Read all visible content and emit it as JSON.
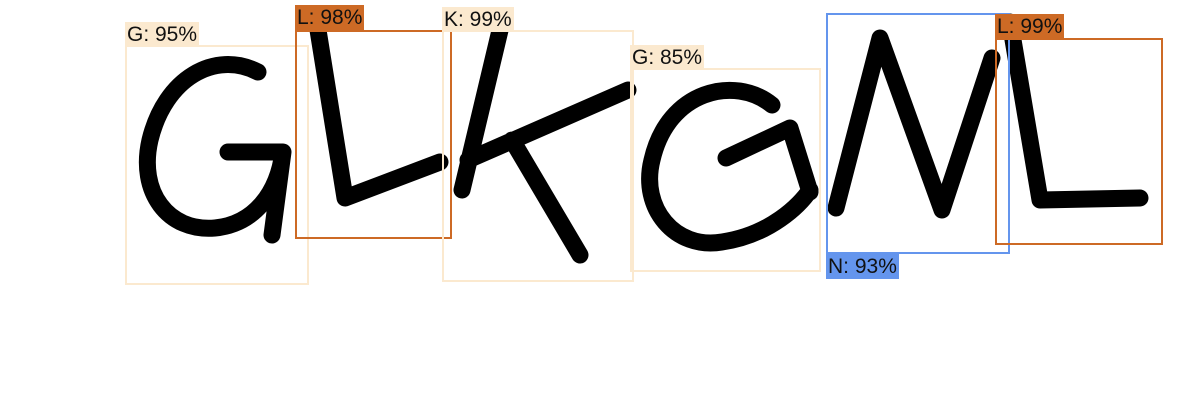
{
  "image": {
    "content": "captcha text rendered in distorted black handwriting with character detection boxes"
  },
  "detections": [
    {
      "label": "G: 95%",
      "char": "G",
      "confidence": 0.95,
      "color": "#fbe9cf"
    },
    {
      "label": "L: 98%",
      "char": "L",
      "confidence": 0.98,
      "color": "#cd6a25"
    },
    {
      "label": "K: 99%",
      "char": "K",
      "confidence": 0.99,
      "color": "#fbe9cf"
    },
    {
      "label": "G: 85%",
      "char": "G",
      "confidence": 0.85,
      "color": "#fbe9cf"
    },
    {
      "label": "N: 93%",
      "char": "N",
      "confidence": 0.93,
      "color": "#6495ed"
    },
    {
      "label": "L: 99%",
      "char": "L",
      "confidence": 0.99,
      "color": "#cd6a25"
    }
  ]
}
